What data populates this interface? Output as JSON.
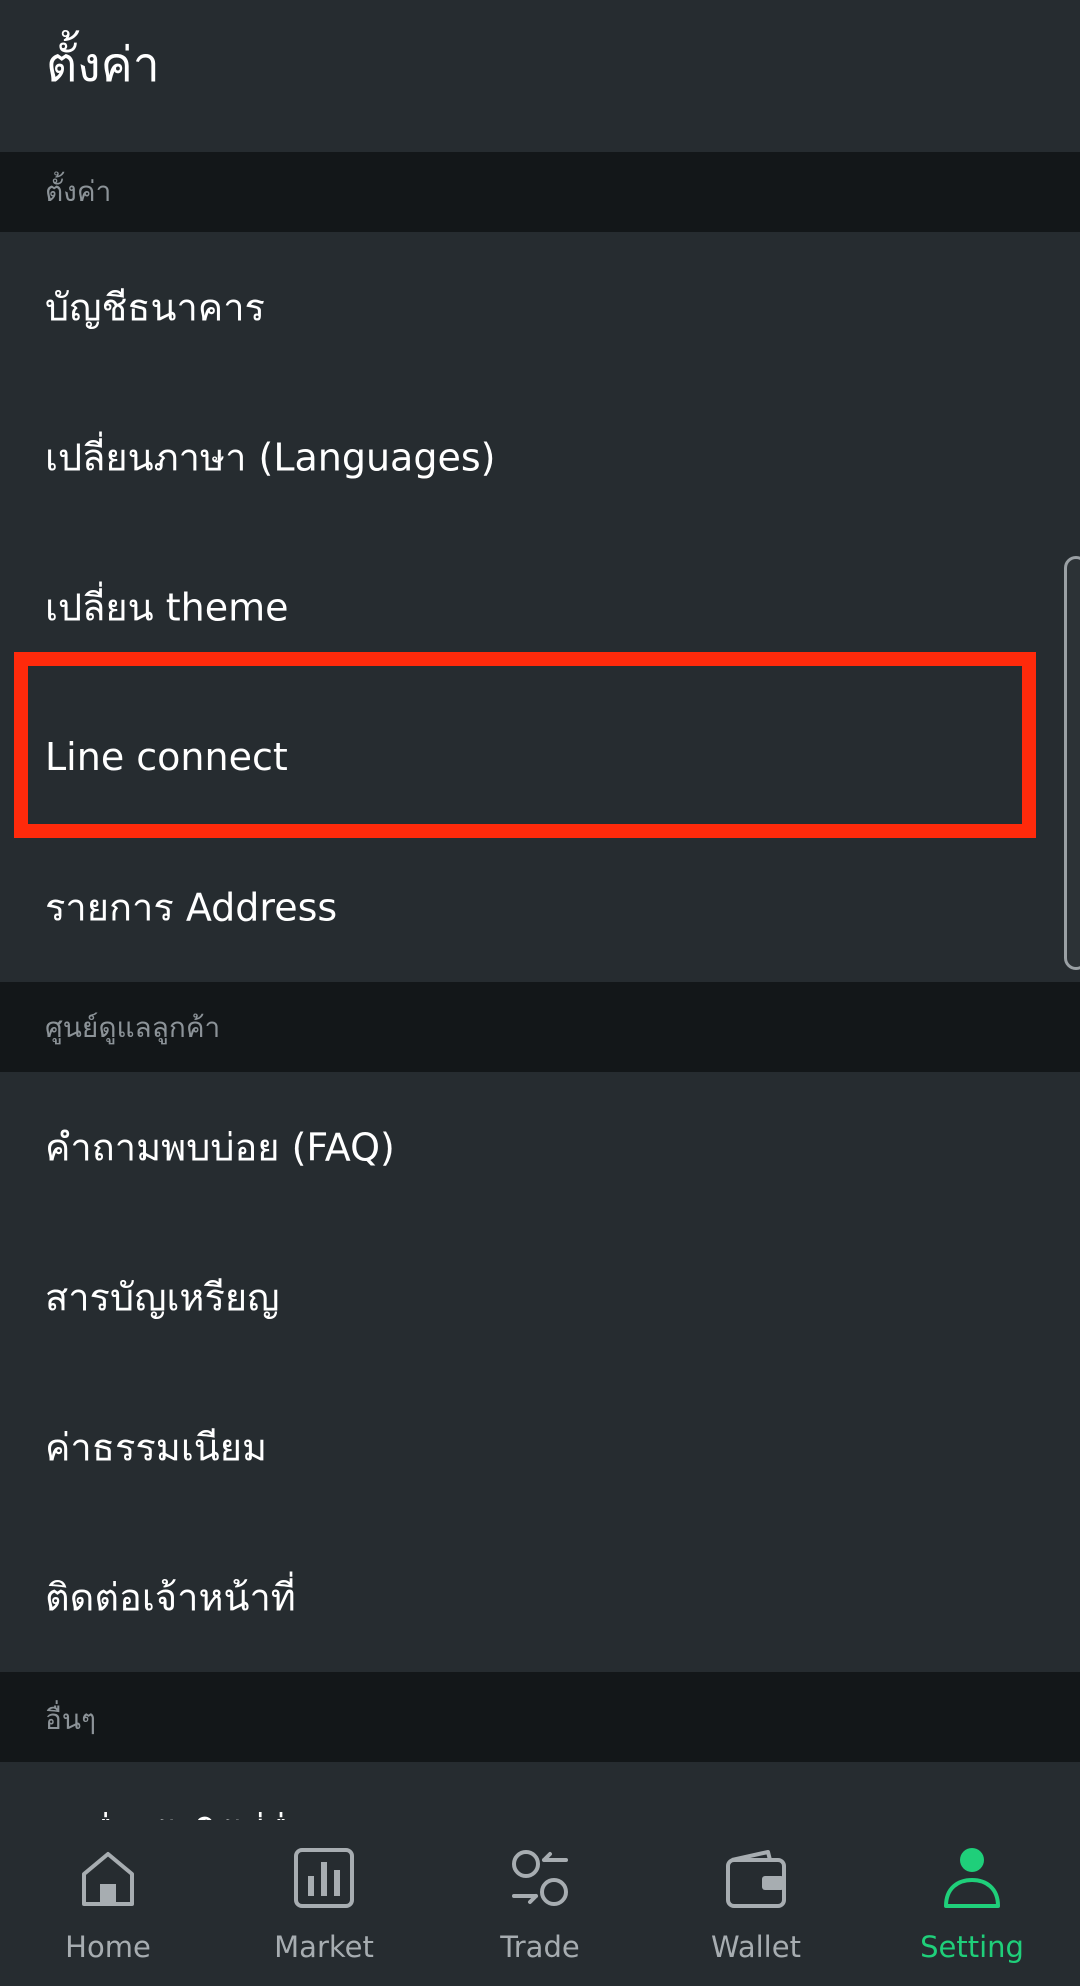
{
  "header": {
    "title": "ตั้งค่า"
  },
  "sections": [
    {
      "title": "ตั้งค่า",
      "items": [
        "บัญชีธนาคาร",
        "เปลี่ยนภาษา (Languages)",
        "เปลี่ยน theme",
        "Line connect",
        "รายการ Address"
      ]
    },
    {
      "title": "ศูนย์ดูแลลูกค้า",
      "items": [
        "คำถามพบบ่อย (FAQ)",
        "สารบัญเหรียญ",
        "ค่าธรรมเนียม",
        "ติดต่อเจ้าหน้าที่"
      ]
    },
    {
      "title": "อื่นๆ",
      "items": [
        "ลงชื่อเข้าใช้ที่อื่น"
      ]
    }
  ],
  "bottom_nav": [
    {
      "label": "Home",
      "icon": "home-icon"
    },
    {
      "label": "Market",
      "icon": "bar-chart-icon"
    },
    {
      "label": "Trade",
      "icon": "exchange-icon"
    },
    {
      "label": "Wallet",
      "icon": "wallet-icon"
    },
    {
      "label": "Setting",
      "icon": "user-icon",
      "active": true
    }
  ],
  "colors": {
    "background": "#262c30",
    "section_background": "#131719",
    "accent": "#1fcf7a",
    "highlight": "#ff2a0b"
  }
}
